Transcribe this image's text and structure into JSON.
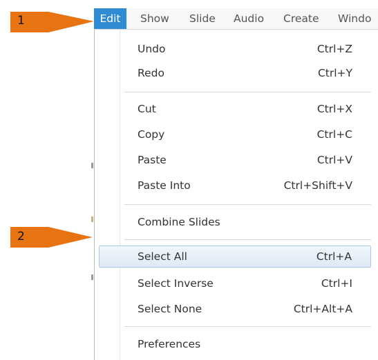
{
  "callouts": [
    {
      "number": "1",
      "color": "#e87411"
    },
    {
      "number": "2",
      "color": "#e87411"
    }
  ],
  "menubar": {
    "items": [
      "Edit",
      "Show",
      "Slide",
      "Audio",
      "Create",
      "Windo"
    ],
    "active_color": "#2f8bd4"
  },
  "menu": {
    "items": [
      {
        "label": "Undo",
        "shortcut": "Ctrl+Z"
      },
      {
        "label": "Redo",
        "shortcut": "Ctrl+Y"
      },
      {
        "label": "Cut",
        "shortcut": "Ctrl+X"
      },
      {
        "label": "Copy",
        "shortcut": "Ctrl+C"
      },
      {
        "label": "Paste",
        "shortcut": "Ctrl+V"
      },
      {
        "label": "Paste Into",
        "shortcut": "Ctrl+Shift+V"
      },
      {
        "label": "Combine Slides",
        "shortcut": ""
      },
      {
        "label": "Select All",
        "shortcut": "Ctrl+A",
        "highlighted": true
      },
      {
        "label": "Select Inverse",
        "shortcut": "Ctrl+I"
      },
      {
        "label": "Select None",
        "shortcut": "Ctrl+Alt+A"
      },
      {
        "label": "Preferences",
        "shortcut": ""
      }
    ]
  }
}
